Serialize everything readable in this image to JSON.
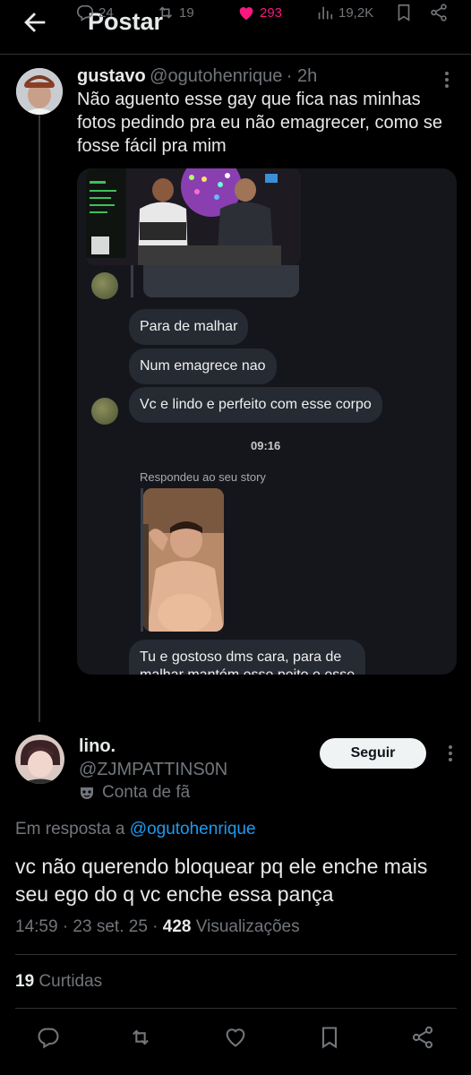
{
  "header": {
    "title": "Postar"
  },
  "original_post": {
    "name": "gustavo",
    "handle": "@ogutohenrique",
    "age": "· 2h",
    "text": "Não aguento esse gay que fica nas minhas fotos pedindo pra eu não emagrecer, como se fosse fácil pra mim",
    "chat": {
      "messages": [
        "Para de malhar",
        "Num emagrece nao",
        "Vc e lindo e perfeito com esse corpo"
      ],
      "time": "09:16",
      "replied_label": "Respondeu ao seu story",
      "last_message_line1": "Tu e gostoso dms cara, para de",
      "last_message_line2": "malhar mantém esse peito e esse"
    },
    "stats": {
      "replies": "24",
      "reposts": "19",
      "likes": "293",
      "views": "19,2K"
    },
    "colors": {
      "like": "#f91880",
      "muted": "#71767b"
    }
  },
  "reply": {
    "name": "lino.",
    "handle": "@ZJMPATTINS0N",
    "badge": "Conta de fã",
    "badge_icon": "mask-icon",
    "follow_label": "Seguir",
    "in_reply_prefix": "Em resposta a",
    "in_reply_handle": "@ogutohenrique",
    "text": "vc não querendo bloquear pq ele enche mais seu ego do q vc enche essa pança",
    "time": "14:59 · 23 set. 25 ·",
    "views_count": "428",
    "views_label": "Visualizações",
    "likes_count": "19",
    "likes_label": "Curtidas",
    "colors": {
      "link": "#1d9bf0"
    }
  }
}
